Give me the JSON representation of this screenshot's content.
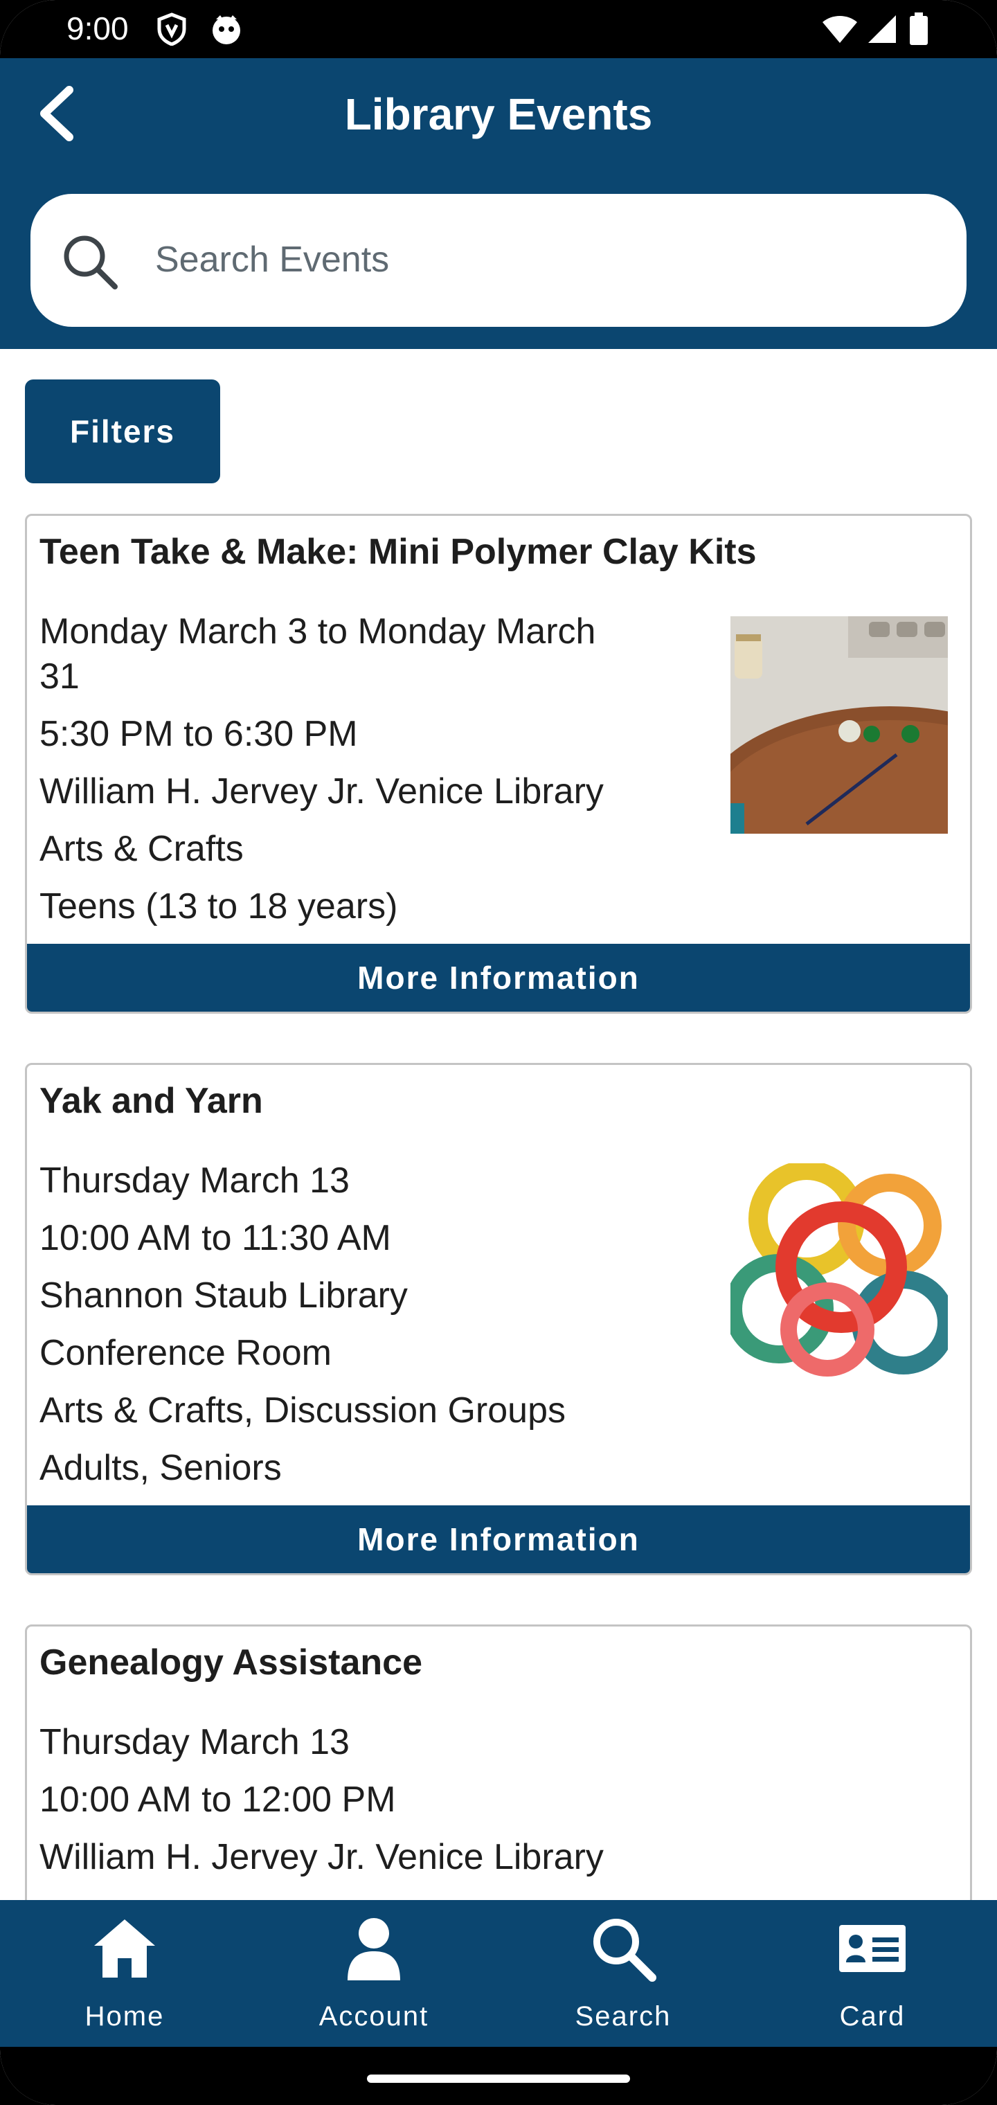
{
  "status": {
    "time": "9:00"
  },
  "header": {
    "title": "Library Events"
  },
  "search": {
    "placeholder": "Search Events"
  },
  "filters": {
    "label": "Filters"
  },
  "events": [
    {
      "title": "Teen Take & Make: Mini Polymer Clay Kits",
      "date": "Monday March 3 to Monday March 31",
      "date_line1": "Monday March 3 to Monday March",
      "date_line2": "31",
      "time": "5:30 PM to 6:30 PM",
      "location": "William H. Jervey Jr. Venice Library",
      "category": "Arts & Crafts",
      "audience": "Teens (13 to 18 years)",
      "button": "More Information"
    },
    {
      "title": "Yak and Yarn",
      "date": "Thursday March 13",
      "time": "10:00 AM to 11:30 AM",
      "location": "Shannon Staub Library",
      "room": "Conference Room",
      "category": "Arts & Crafts, Discussion Groups",
      "audience": "Adults, Seniors",
      "button": "More Information"
    },
    {
      "title": "Genealogy Assistance",
      "date": "Thursday March 13",
      "time": "10:00 AM to 12:00 PM",
      "location": "William H. Jervey Jr. Venice Library"
    }
  ],
  "nav": [
    {
      "label": "Home",
      "icon": "home-icon"
    },
    {
      "label": "Account",
      "icon": "account-icon"
    },
    {
      "label": "Search",
      "icon": "search-icon"
    },
    {
      "label": "Card",
      "icon": "card-icon"
    }
  ],
  "colors": {
    "primary": "#0b4670",
    "border": "#c4c4c4",
    "text": "#1e1e1e"
  }
}
